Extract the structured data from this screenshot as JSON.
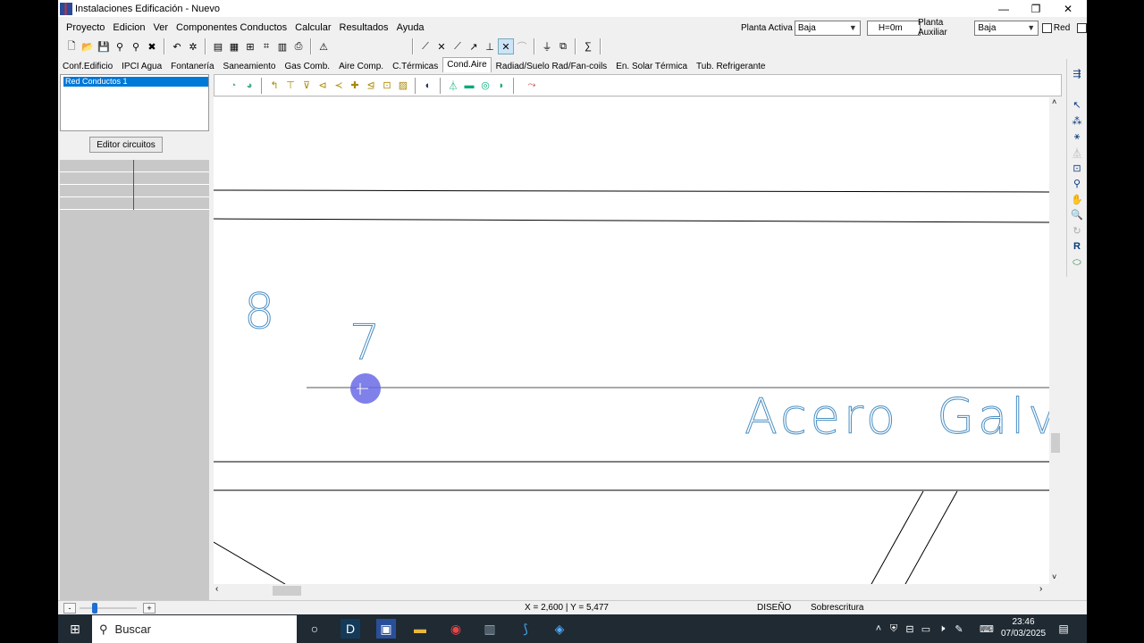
{
  "window": {
    "title": "Instalaciones Edificación - Nuevo",
    "minimize": "—",
    "restore": "❐",
    "close": "✕"
  },
  "menu": [
    "Proyecto",
    "Edicion",
    "Ver",
    "Componentes Conductos",
    "Calcular",
    "Resultados",
    "Ayuda"
  ],
  "planta": {
    "activa_label": "Planta Activa",
    "activa_value": "Baja",
    "height_value": "H=0m",
    "auxiliar_label": "Planta Auxiliar",
    "auxiliar_value": "Baja",
    "red_label": "Red"
  },
  "tabs": [
    "Conf.Edificio",
    "IPCI Agua",
    "Fontanería",
    "Saneamiento",
    "Gas Comb.",
    "Aire Comp.",
    "C.Térmicas",
    "Cond.Aire",
    "Radiad/Suelo Rad/Fan-coils",
    "En. Solar Térmica",
    "Tub. Refrigerante"
  ],
  "active_tab": "Cond.Aire",
  "tree": {
    "item": "Red Conductos 1"
  },
  "editor_button": "Editor circuitos",
  "canvas": {
    "label_8": "8",
    "label_7": "7",
    "material": "Acero  Galv."
  },
  "status": {
    "zoom_minus": "-",
    "zoom_plus": "+",
    "coords": "X = 2,600 | Y = 5,477",
    "mode": "DISEÑO",
    "overwrite": "Sobrescritura"
  },
  "taskbar": {
    "search_placeholder": "Buscar",
    "time": "23:46",
    "date": "07/03/2025"
  },
  "colors": {
    "drawing_text": "#4a8fc4",
    "cursor_circle": "#6a6ae8",
    "selection": "#0078d7"
  }
}
